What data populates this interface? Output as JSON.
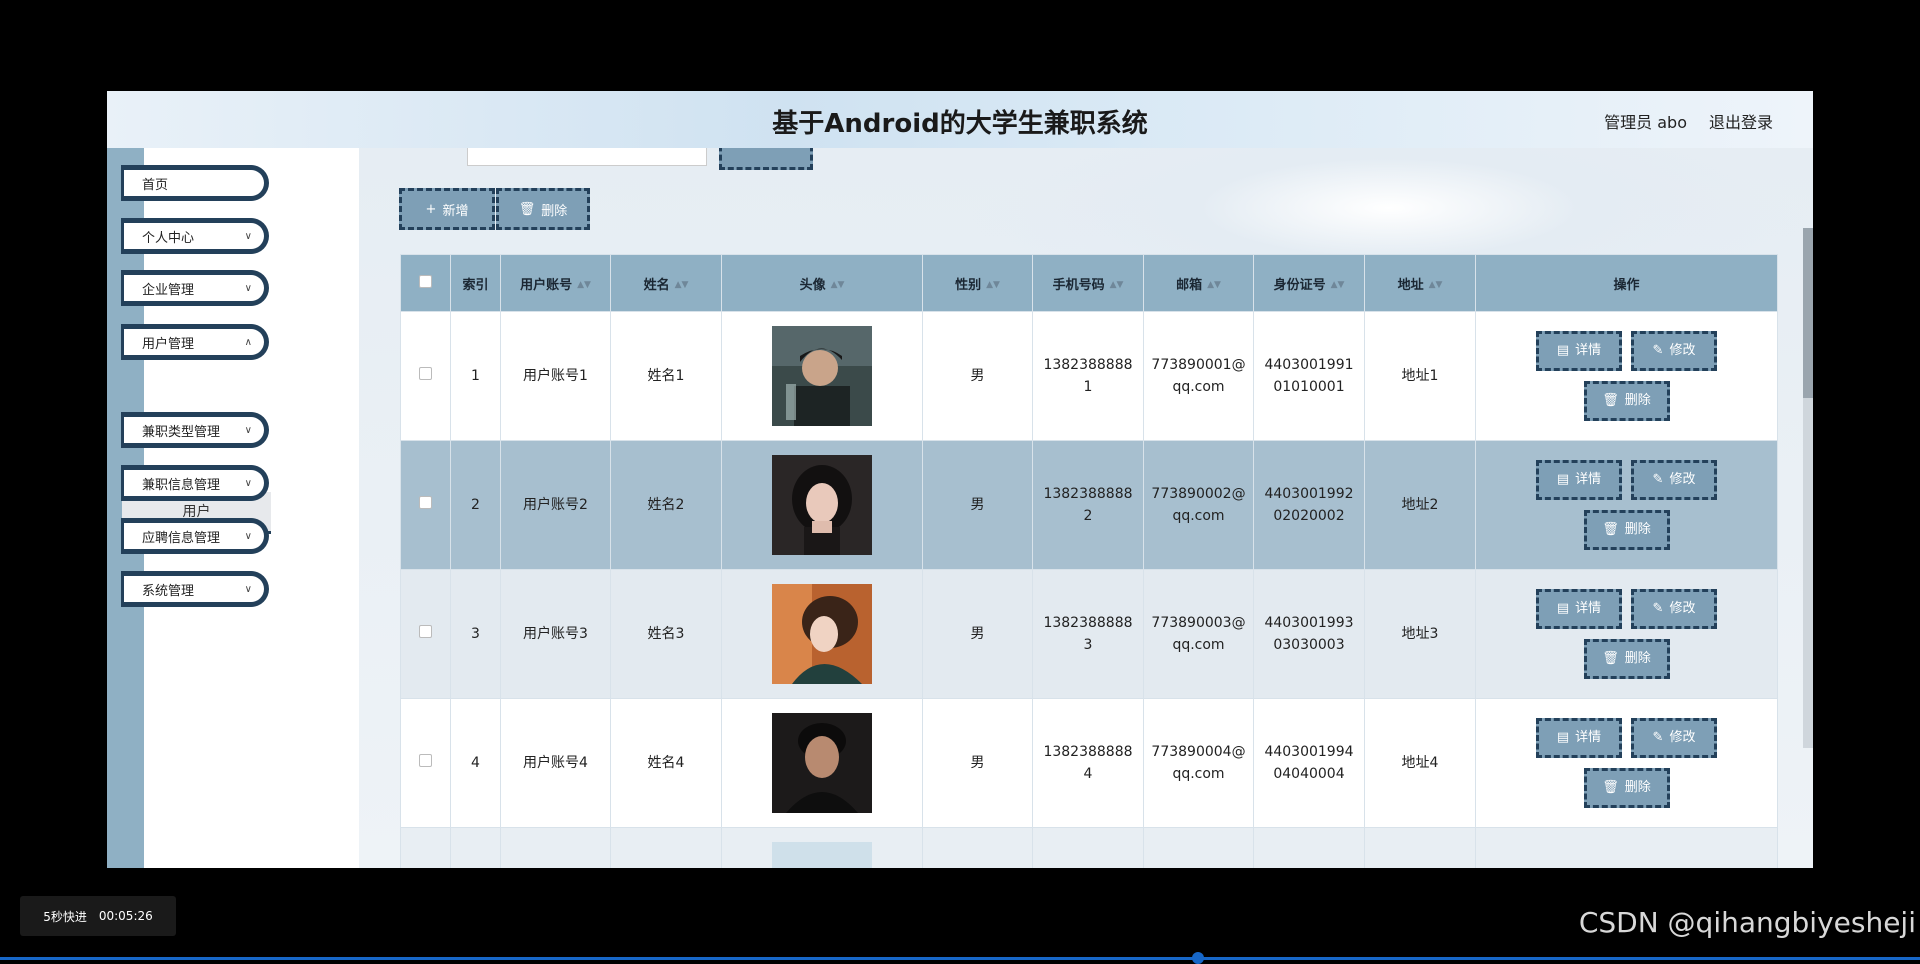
{
  "header": {
    "title": "基于Android的大学生兼职系统",
    "admin_label": "管理员 abo",
    "logout_label": "退出登录"
  },
  "sidebar": {
    "items": [
      {
        "label": "首页",
        "has_chevron": false
      },
      {
        "label": "个人中心",
        "has_chevron": true
      },
      {
        "label": "企业管理",
        "has_chevron": true
      },
      {
        "label": "用户管理",
        "has_chevron": true
      },
      {
        "label": "兼职类型管理",
        "has_chevron": true
      },
      {
        "label": "兼职信息管理",
        "has_chevron": true
      },
      {
        "label": "应聘信息管理",
        "has_chevron": true
      },
      {
        "label": "系统管理",
        "has_chevron": true
      }
    ],
    "submenu_label": "用户"
  },
  "toolbar": {
    "add_label": "新增",
    "delete_label": "删除",
    "add_icon": "plus-icon",
    "delete_icon": "trash-icon"
  },
  "table": {
    "headers": {
      "index": "索引",
      "account": "用户账号",
      "name": "姓名",
      "avatar": "头像",
      "gender": "性别",
      "phone": "手机号码",
      "email": "邮箱",
      "id_card": "身份证号",
      "address": "地址",
      "ops": "操作"
    },
    "rows": [
      {
        "index": "1",
        "account": "用户账号1",
        "name": "姓名1",
        "gender": "男",
        "phone_line1": "1382388888",
        "phone_line2": "1",
        "email_line1": "773890001@",
        "email_line2": "qq.com",
        "id_line1": "4403001991",
        "id_line2": "01010001",
        "address": "地址1"
      },
      {
        "index": "2",
        "account": "用户账号2",
        "name": "姓名2",
        "gender": "男",
        "phone_line1": "1382388888",
        "phone_line2": "2",
        "email_line1": "773890002@",
        "email_line2": "qq.com",
        "id_line1": "4403001992",
        "id_line2": "02020002",
        "address": "地址2"
      },
      {
        "index": "3",
        "account": "用户账号3",
        "name": "姓名3",
        "gender": "男",
        "phone_line1": "1382388888",
        "phone_line2": "3",
        "email_line1": "773890003@",
        "email_line2": "qq.com",
        "id_line1": "4403001993",
        "id_line2": "03030003",
        "address": "地址3"
      },
      {
        "index": "4",
        "account": "用户账号4",
        "name": "姓名4",
        "gender": "男",
        "phone_line1": "1382388888",
        "phone_line2": "4",
        "email_line1": "773890004@",
        "email_line2": "qq.com",
        "id_line1": "4403001994",
        "id_line2": "04040004",
        "address": "地址4"
      }
    ],
    "op_labels": {
      "detail": "详情",
      "edit": "修改",
      "delete": "删除"
    }
  },
  "player": {
    "skip_label": "5秒快进",
    "time": "00:05:26"
  },
  "watermark": "CSDN @qihangbiyesheji"
}
